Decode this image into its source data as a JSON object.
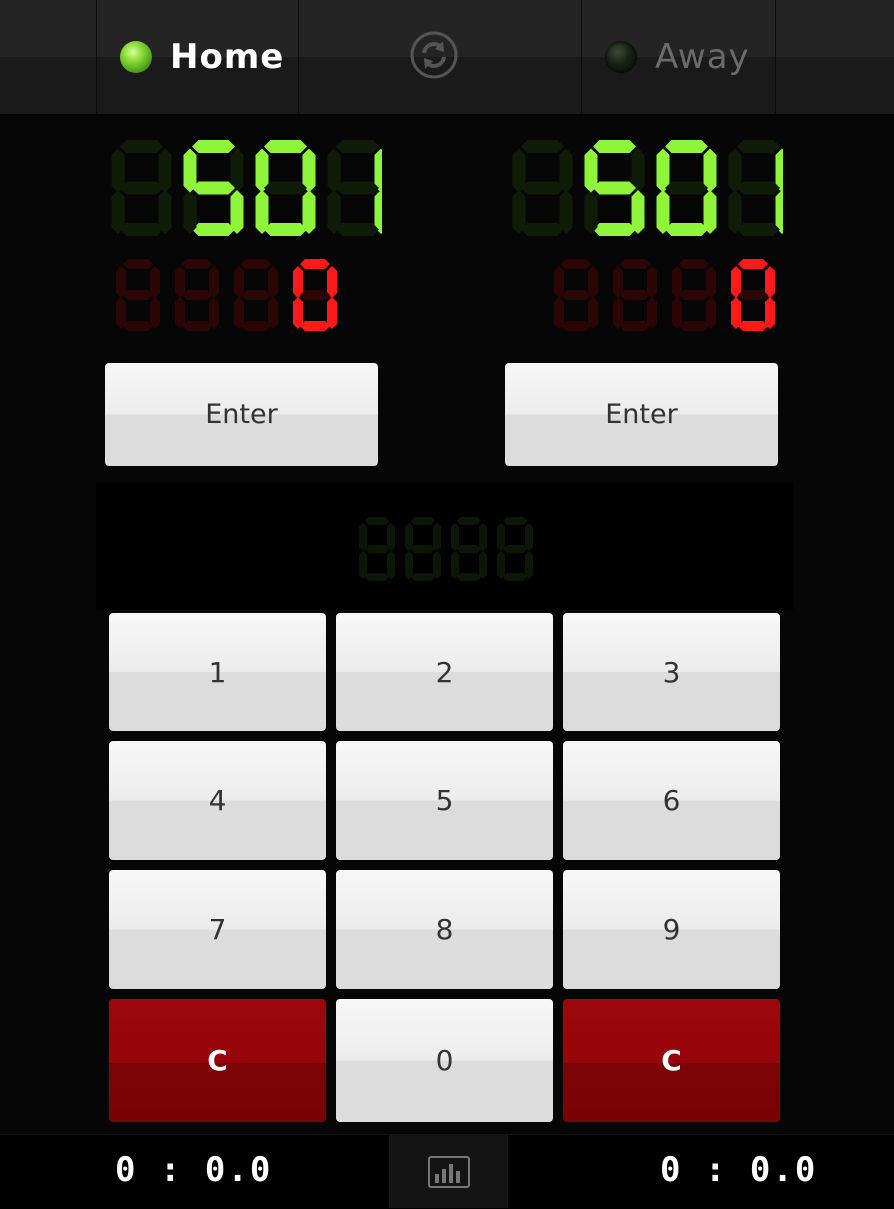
{
  "header": {
    "home_label": "Home",
    "away_label": "Away",
    "home_active": true,
    "away_active": false
  },
  "players": [
    {
      "name": "home",
      "score": "501",
      "darts": "0"
    },
    {
      "name": "away",
      "score": "501",
      "darts": "0"
    }
  ],
  "buttons": {
    "enter_home": "Enter",
    "enter_away": "Enter"
  },
  "entry_display": "",
  "keypad": [
    [
      "1",
      "2",
      "3"
    ],
    [
      "4",
      "5",
      "6"
    ],
    [
      "7",
      "8",
      "9"
    ],
    [
      "C",
      "0",
      "C"
    ]
  ],
  "footer": {
    "home_timer": "0 : 0.0",
    "away_timer": "0 : 0.0"
  },
  "colors": {
    "score_on": "#8ef53a",
    "score_off": "#0f1c08",
    "darts_on": "#ff1a1a",
    "darts_off": "#2c0505",
    "entry_off": "#0c1806",
    "active_label": "#ffffff",
    "inactive_label": "#6b6b6b",
    "clear_button": "#960509"
  },
  "icons": {
    "sync": "sync-icon",
    "stats": "bar-chart-icon"
  }
}
